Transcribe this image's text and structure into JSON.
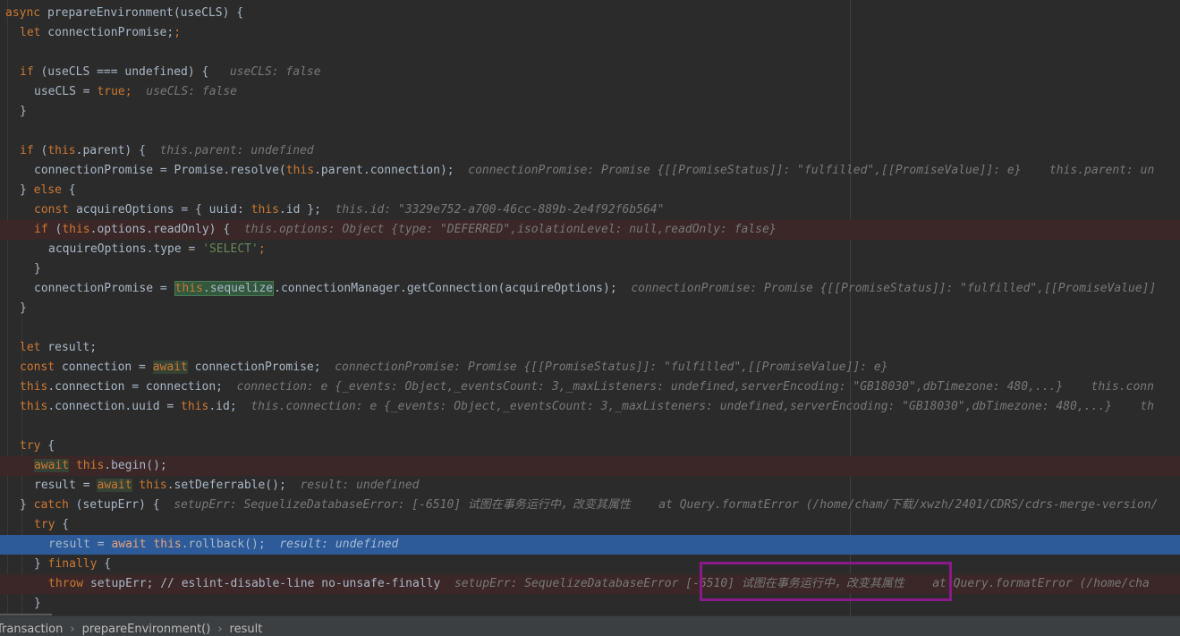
{
  "code": {
    "l1": {
      "kw": "async",
      "rest": " prepareEnvironment(useCLS) {"
    },
    "l2": {
      "kw": "let",
      "rest": " connectionPromise;"
    },
    "l4": {
      "kw": "if",
      "rest": " (useCLS === undefined) {",
      "hint": "useCLS: false"
    },
    "l5": {
      "pre": "useCLS = ",
      "kw": "true",
      "semi": ";",
      "hint": "useCLS: false"
    },
    "l6": {
      "text": "}"
    },
    "l8": {
      "kw": "if",
      "p1": " (",
      "this": "this",
      "p2": ".parent) {",
      "hint": "this.parent: undefined"
    },
    "l9": {
      "pre": "connectionPromise = Promise.resolve(",
      "this": "this",
      "post": ".parent.connection);",
      "hint": "connectionPromise: Promise {[[PromiseStatus]]: \"fulfilled\",[[PromiseValue]]: e}",
      "hint2": "this.parent: un"
    },
    "l10": {
      "pre": "} ",
      "kw": "else",
      "post": " {"
    },
    "l11": {
      "kw": "const",
      "pre": " acquireOptions = { uuid: ",
      "this": "this",
      "post": ".id };",
      "hint": "this.id: \"3329e752-a700-46cc-889b-2e4f92f6b564\""
    },
    "l12": {
      "kw": "if",
      "p1": " (",
      "this": "this",
      "p2": ".options.readOnly) {",
      "hint": "this.options: Object {type: \"DEFERRED\",isolationLevel: null,readOnly: false}"
    },
    "l13": {
      "pre": "acquireOptions.type = ",
      "str": "'SELECT'",
      "semi": ";"
    },
    "l14": {
      "text": "}"
    },
    "l15": {
      "pre": "connectionPromise = ",
      "this": "this",
      "dot": ".",
      "seq": "sequelize",
      "post": ".connectionManager.getConnection(acquireOptions);",
      "hint": "connectionPromise: Promise {[[PromiseStatus]]: \"fulfilled\",[[PromiseValue]]"
    },
    "l16": {
      "text": "}"
    },
    "l18": {
      "kw": "let",
      "rest": " result;"
    },
    "l19": {
      "kw": "const",
      "pre": " connection = ",
      "aw": "await",
      "post": " connectionPromise;",
      "hint": "connectionPromise: Promise {[[PromiseStatus]]: \"fulfilled\",[[PromiseValue]]: e}"
    },
    "l20": {
      "this": "this",
      "post": ".connection = connection;",
      "hint": "connection: e {_events: Object,_eventsCount: 3,_maxListeners: undefined,serverEncoding: \"GB18030\",dbTimezone: 480,...}",
      "hint2": "this.conn"
    },
    "l21": {
      "this": "this",
      "mid": ".connection.uuid = ",
      "this2": "this",
      "post": ".id;",
      "hint": "this.connection: e {_events: Object,_eventsCount: 3,_maxListeners: undefined,serverEncoding: \"GB18030\",dbTimezone: 480,...}",
      "hint2": "th"
    },
    "l23": {
      "kw": "try",
      "rest": " {"
    },
    "l24": {
      "aw": "await",
      "sp": " ",
      "this": "this",
      "post": ".begin();"
    },
    "l25": {
      "pre": "result = ",
      "aw": "await",
      "sp": " ",
      "this": "this",
      "post": ".setDeferrable();",
      "hint": "result: undefined"
    },
    "l26": {
      "pre": "} ",
      "kw": "catch",
      "post": " (setupErr) {",
      "hint": "setupErr: SequelizeDatabaseError: [-6510] 试图在事务运行中，改变其属性",
      "hint2": "at Query.formatError (/home/cham/下载/xwzh/2401/CDRS/cdrs-merge-version/"
    },
    "l27": {
      "kw": "try",
      "rest": " {"
    },
    "l28": {
      "pre": "result = ",
      "aw": "await",
      "sp": " ",
      "this": "this",
      "post": ".rollback();",
      "hint": "result: undefined"
    },
    "l29": {
      "pre": "} ",
      "kw": "finally",
      "post": " {"
    },
    "l30": {
      "kw": "throw",
      "pre": " setupErr; ",
      "cmt": "// eslint-disable-line no-unsafe-finally",
      "hint": "setupErr: SequelizeDatabaseError",
      "hint_err": "[-6510] 试图在事务运行中，改变其属性",
      "hint2": "at Query.formatError (/home/cha"
    },
    "l31": {
      "text": "}"
    }
  },
  "breadcrumb": {
    "items": [
      "Transaction",
      "prepareEnvironment()",
      "result"
    ],
    "sep": "›"
  }
}
